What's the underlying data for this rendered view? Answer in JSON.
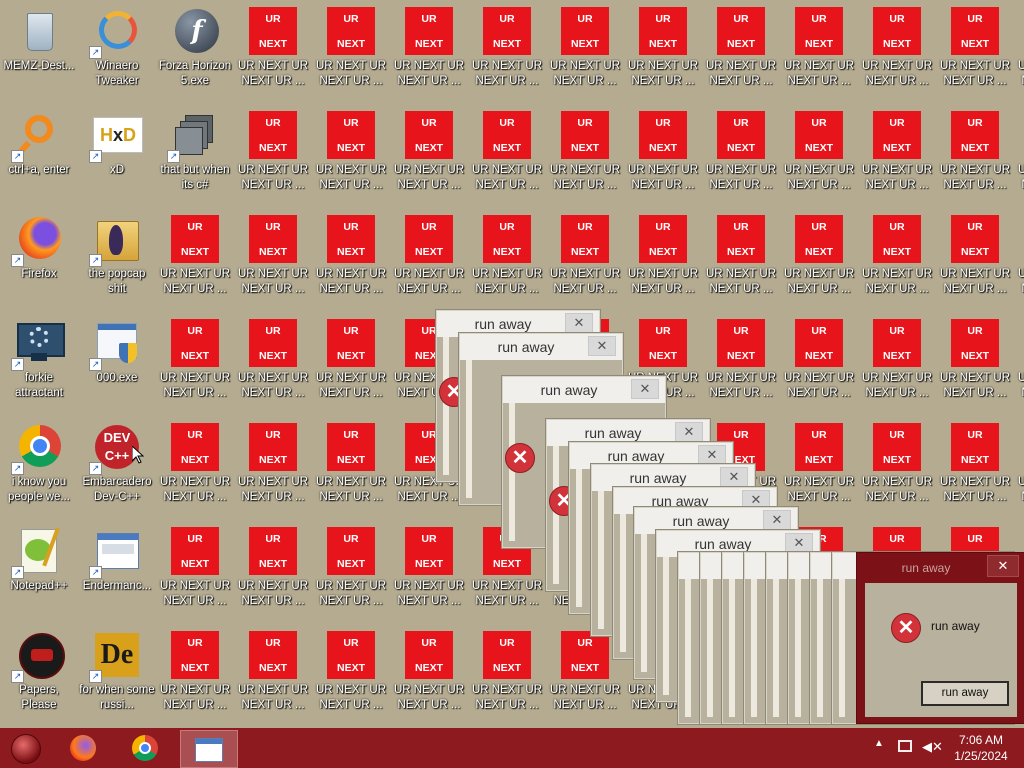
{
  "desktop": {
    "icons": [
      {
        "label": "MEMZ-Dest...",
        "icon": "recycle-bin-icon"
      },
      {
        "label": "Winaero Tweaker",
        "icon": "winaero-icon"
      },
      {
        "label": "Forza Horizon 5.exe",
        "icon": "flash-icon"
      },
      {
        "label": "ctrl+a, enter",
        "icon": "magnifier-icon"
      },
      {
        "label": "xD",
        "icon": "hxd-icon"
      },
      {
        "label": "that but when its c#",
        "icon": "windows-stack-icon"
      },
      {
        "label": "Firefox",
        "icon": "firefox-icon"
      },
      {
        "label": "the popcap shit",
        "icon": "folder-icon"
      },
      {
        "label": "forkie attractant",
        "icon": "computer-settings-icon"
      },
      {
        "label": "000.exe",
        "icon": "installer-icon"
      },
      {
        "label": "i know you people we...",
        "icon": "chrome-icon"
      },
      {
        "label": "Embarcadero Dev-C++",
        "icon": "devcpp-icon"
      },
      {
        "label": "Notepad++",
        "icon": "notepadpp-icon"
      },
      {
        "label": "Endermanc...",
        "icon": "window-app-icon"
      },
      {
        "label": "Papers, Please",
        "icon": "papers-please-icon"
      },
      {
        "label": "for when some russi...",
        "icon": "de-icon"
      }
    ],
    "ur_tile": {
      "top": "UR",
      "bottom": "NEXT",
      "label": "UR NEXT UR NEXT UR ..."
    },
    "partial_label": "UR NEXT UI"
  },
  "windows": {
    "title": "run away",
    "close_glyph": "✕"
  },
  "dialog": {
    "title": "run away",
    "message": "run away",
    "button": "run away",
    "close_glyph": "✕"
  },
  "taskbar": {
    "time": "7:06 AM",
    "date": "1/25/2024",
    "apps": [
      "start-orb-icon",
      "firefox-icon",
      "chrome-icon",
      "window-app-icon"
    ],
    "tray": [
      "tray-arrow-icon",
      "network-icon",
      "speaker-muted-icon"
    ]
  },
  "colors": {
    "desktop_bg": "#b4ab90",
    "taskbar": "#8c1a1e",
    "ur_red": "#e8141c",
    "dialog_frame": "#7c1217"
  }
}
